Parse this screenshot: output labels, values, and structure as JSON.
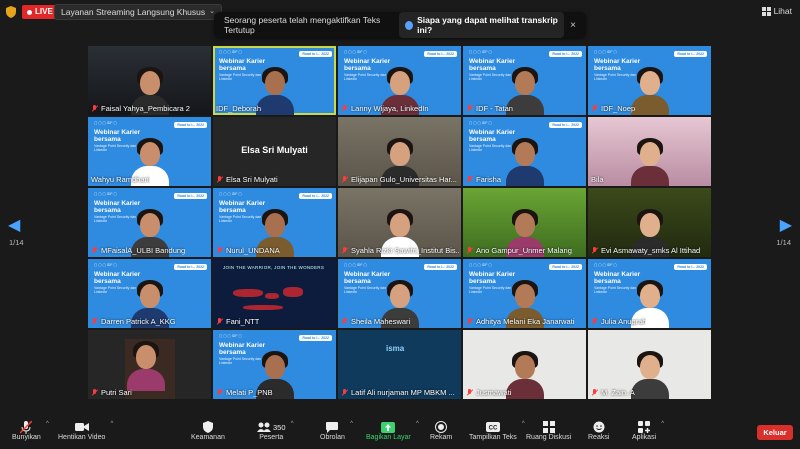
{
  "topbar": {
    "live_label": "LIVE",
    "stream_label": "Layanan Streaming Langsung Khusus",
    "view_label": "Lihat"
  },
  "notice": {
    "text": "Seorang peserta telah mengaktifkan Teks Tertutup",
    "link": "Siapa yang dapat melihat transkrip ini?",
    "close": "×"
  },
  "pager": {
    "left": "1/14",
    "right": "1/14",
    "prev": "◀",
    "next": "▶"
  },
  "banner": {
    "title_line1": "Webinar Karier bersama",
    "title_line2": "Vantage Point Security dan LinkedIn",
    "badge": "Road to I... 2022",
    "logos": "▢ ▢ ▢ IDF ▢"
  },
  "tiles": [
    {
      "name": "Faisal Yahya_Pembicara 2",
      "bg": "studio",
      "muted": true
    },
    {
      "name": "IDF_Deborah",
      "bg": "blue",
      "muted": false,
      "active": true
    },
    {
      "name": "Lanny Wijaya, LinkedIn",
      "bg": "blue",
      "muted": true
    },
    {
      "name": "IDF - Tatan",
      "bg": "blue",
      "muted": true
    },
    {
      "name": "IDF_Noep",
      "bg": "blue",
      "muted": true
    },
    {
      "name": "Wahyu Ramdhani",
      "bg": "blue",
      "muted": false
    },
    {
      "name": "Elsa Sri Mulyati",
      "bg": "dark",
      "muted": true,
      "center": "Elsa Sri Mulyati"
    },
    {
      "name": "Elijapan Gulo_Universitas Har...",
      "bg": "room",
      "muted": true
    },
    {
      "name": "Farisha",
      "bg": "blue",
      "muted": true
    },
    {
      "name": "Bila",
      "bg": "pink",
      "muted": false
    },
    {
      "name": "MFaisalA_ULBI Bandung",
      "bg": "blue",
      "muted": true
    },
    {
      "name": "Nurul_UNDANA",
      "bg": "blue",
      "muted": true
    },
    {
      "name": "Syahla Rizki Sawitri_Institut Bis...",
      "bg": "room",
      "muted": true
    },
    {
      "name": "Ano Gampur_Unmer Malang",
      "bg": "green",
      "muted": true
    },
    {
      "name": "Evi Asmawaty_smks Al Ittihad",
      "bg": "olive",
      "muted": true
    },
    {
      "name": "Darren Patrick A_KKG",
      "bg": "blue",
      "muted": true
    },
    {
      "name": "Fani_NTT",
      "bg": "map",
      "muted": true,
      "map_text": "JOIN THE WARRIOR, JOIN THE WONDERS"
    },
    {
      "name": "Sheila Maheswari",
      "bg": "blue",
      "muted": true
    },
    {
      "name": "Adhitya Melani Eka Janarwati",
      "bg": "blue",
      "muted": true
    },
    {
      "name": "Julia Anugrah",
      "bg": "blue",
      "muted": true
    },
    {
      "name": "Putri Sari",
      "bg": "dark",
      "muted": true
    },
    {
      "name": "Melati P_PNB",
      "bg": "blue",
      "muted": true
    },
    {
      "name": "Latif Ali nurjaman MP MBKM ...",
      "bg": "tech",
      "muted": true,
      "tech_text": "isma"
    },
    {
      "name": "Jusmawati",
      "bg": "white",
      "muted": true
    },
    {
      "name": "M. Zain. A",
      "bg": "white",
      "muted": true
    }
  ],
  "toolbar": {
    "unmute": "Bunyikan",
    "stop_video": "Hentikan Video",
    "security": "Keamanan",
    "participants": "Peserta",
    "participants_count": "350",
    "chat": "Obrolan",
    "share": "Bagikan Layar",
    "record": "Rekam",
    "captions": "Tampilkan Teks",
    "rooms": "Ruang Diskusi",
    "reactions": "Reaksi",
    "apps": "Aplikasi",
    "leave": "Keluar"
  },
  "colors": {
    "accent_blue": "#2f8be0",
    "share_green": "#3bd16f",
    "leave_red": "#d9302b",
    "live_red": "#e02828"
  }
}
